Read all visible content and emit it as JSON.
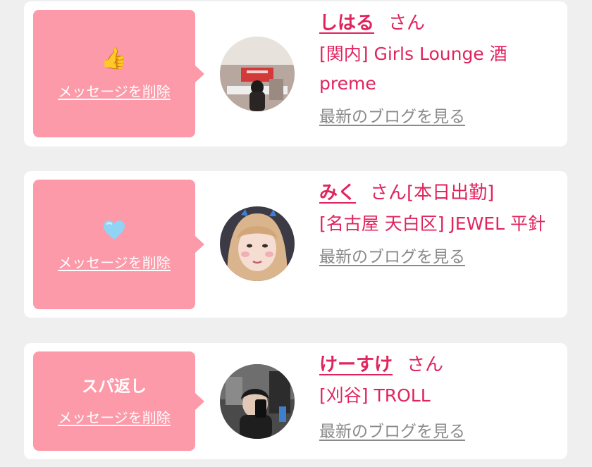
{
  "colors": {
    "background": "#efefef",
    "card": "#ffffff",
    "bubble": "#fc9aa9",
    "accent": "#e0245e",
    "muted_link": "#8a8a8a"
  },
  "messages": [
    {
      "reaction_icon": "thumbs-up-icon",
      "reaction_glyph": "👍",
      "delete_label": "メッセージを削除",
      "name": "しはる",
      "honorific": "さん",
      "status": "",
      "shop": "[関内] Girls Lounge 酒preme",
      "blog_label": "最新のブログを見る"
    },
    {
      "reaction_icon": "light-blue-heart-icon",
      "reaction_glyph": "🩵",
      "delete_label": "メッセージを削除",
      "name": "みく",
      "honorific": "さん",
      "status": "[本日出勤]",
      "shop": "[名古屋 天白区] JEWEL 平針",
      "blog_label": "最新のブログを見る"
    },
    {
      "reaction_text": "スパ返し",
      "delete_label": "メッセージを削除",
      "name": "けーすけ",
      "honorific": "さん",
      "status": "",
      "shop": "[刈谷] TROLL",
      "blog_label": "最新のブログを見る"
    }
  ]
}
